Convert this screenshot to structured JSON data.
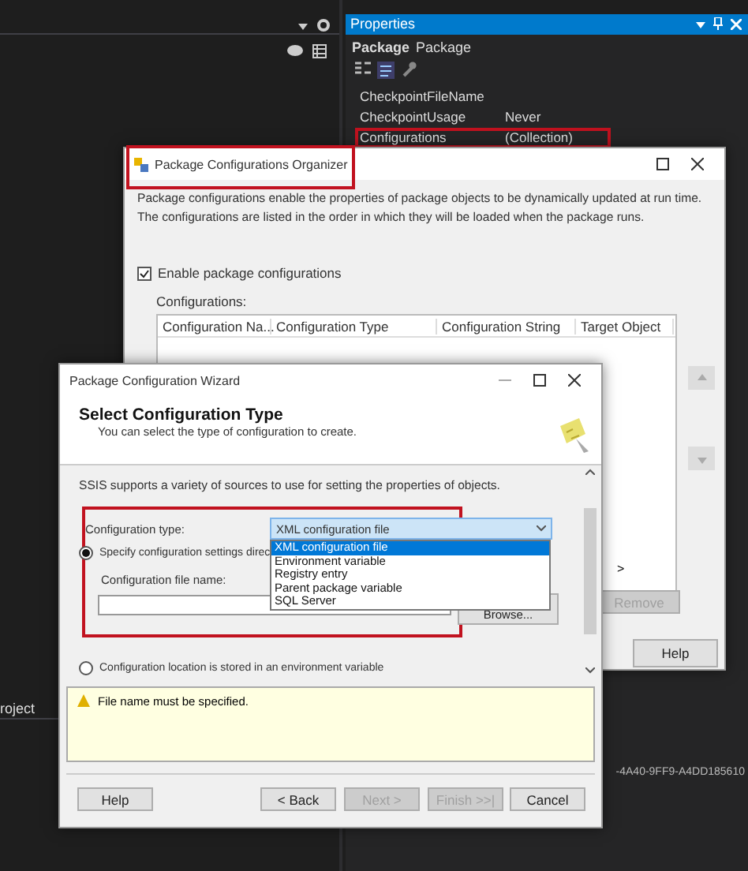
{
  "ide": {
    "left_tab": "roject",
    "properties": {
      "title": "Properties",
      "object_name": "Package",
      "object_type": "Package",
      "rows": [
        {
          "name": "CheckpointFileName",
          "value": "",
          "highlighted": false
        },
        {
          "name": "CheckpointUsage",
          "value": "Never",
          "highlighted": false
        },
        {
          "name": "Configurations",
          "value": "(Collection)",
          "highlighted": true
        }
      ],
      "guid_fragment": "-4A40-9FF9-A4DD185610"
    }
  },
  "organizer": {
    "title": "Package Configurations Organizer",
    "title_highlighted": true,
    "description": [
      "Package configurations enable the properties of package objects to be dynamically updated at run time.",
      "The configurations are listed in the order in which they will be loaded when the package runs."
    ],
    "enable_label": "Enable package configurations",
    "enable_checked": true,
    "list_label": "Configurations:",
    "columns": [
      "Configuration Na...",
      "Configuration Type",
      "Configuration String",
      "Target Object"
    ],
    "scroll_right": ">",
    "remove_button": "Remove",
    "help_button": "Help"
  },
  "wizard": {
    "title": "Package Configuration Wizard",
    "heading": "Select Configuration Type",
    "subheading": "You can select the type of configuration to create.",
    "intro": "SSIS supports a variety of sources to use for setting the properties of objects.",
    "group_highlighted": true,
    "type_label": "Configuration type:",
    "type_value": "XML configuration file",
    "options": [
      {
        "label": "XML configuration file",
        "selected": true
      },
      {
        "label": "Environment variable",
        "selected": false
      },
      {
        "label": "Registry entry",
        "selected": false
      },
      {
        "label": "Parent package variable",
        "selected": false
      },
      {
        "label": "SQL Server",
        "selected": false
      }
    ],
    "radios": [
      {
        "label": "Specify configuration settings direc",
        "selected": true
      },
      {
        "label": "Configuration location is stored in an environment variable",
        "selected": false
      }
    ],
    "file_label": "Configuration file name:",
    "browse_button": "Browse...",
    "message": "File name must be specified.",
    "buttons": [
      {
        "label": "Help",
        "disabled": false
      },
      {
        "label": "< Back",
        "disabled": false
      },
      {
        "label": "Next >",
        "disabled": true
      },
      {
        "label": "Finish >>|",
        "disabled": true
      },
      {
        "label": "Cancel",
        "disabled": false
      }
    ]
  }
}
